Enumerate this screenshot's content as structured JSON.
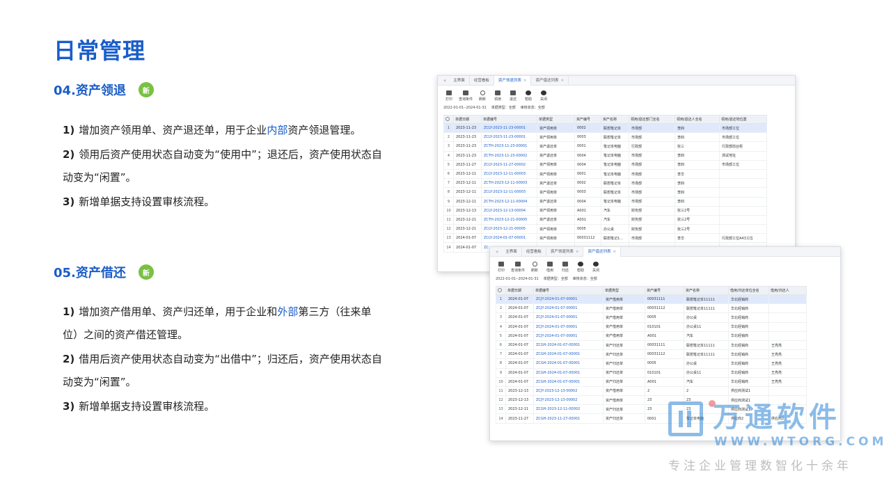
{
  "title": "日常管理",
  "badge": "新",
  "sections": [
    {
      "heading": "04.资产领退",
      "bullets": [
        {
          "num": "1)",
          "pre": "增加资产领用单、资产退还单，用于企业",
          "hl": "内部",
          "post": "资产领退管理。"
        },
        {
          "num": "2)",
          "pre": "领用后资产使用状态自动变为“使用中”；退还后，资产使用状态自动变为“闲置”。",
          "hl": "",
          "post": ""
        },
        {
          "num": "3)",
          "pre": "新增单据支持设置审核流程。",
          "hl": "",
          "post": ""
        }
      ]
    },
    {
      "heading": "05.资产借还",
      "bullets": [
        {
          "num": "1)",
          "pre": "增加资产借用单、资产归还单，用于企业和",
          "hl": "外部",
          "post": "第三方（往来单位）之间的资产借还管理。"
        },
        {
          "num": "2)",
          "pre": "借用后资产使用状态自动变为“出借中”；归还后，资产使用状态自动变为“闲置”。",
          "hl": "",
          "post": ""
        },
        {
          "num": "3)",
          "pre": "新增单据支持设置审核流程。",
          "hl": "",
          "post": ""
        }
      ]
    }
  ],
  "window1": {
    "tabs": [
      "主界面",
      "经营看板",
      "资产领退列表",
      "资产借还列表"
    ],
    "active_tab": 2,
    "toolbar": [
      "打印",
      "查询条件",
      "刷新",
      "领用",
      "退还",
      "帮助",
      "关闭"
    ],
    "filter": [
      "2022-01-01--2024-01-31",
      "单据类型：全部",
      "审核状态：全部"
    ],
    "columns": [
      "",
      "单据日期",
      "单据编号",
      "单据类型",
      "资产编号",
      "资产名称",
      "领用/退还部门全名",
      "领用/退还人全名",
      "领用/退还地位置"
    ],
    "rows": [
      [
        "1",
        "2023-11-23",
        "ZCLY-2023-11-23-00001",
        "资产领用单",
        "0002",
        "联想笔记本",
        "市场部",
        "李四",
        "市场部工位"
      ],
      [
        "2",
        "2023-11-23",
        "ZCLY-2023-11-23-00001",
        "资产领用单",
        "0003",
        "联想笔记本",
        "市场部",
        "李四",
        "市场部工位"
      ],
      [
        "3",
        "2023-11-23",
        "ZCTH-2023-11-23-00001",
        "资产退还单",
        "0001",
        "笔记本电脑",
        "行政部",
        "张三",
        "行政部前台柜"
      ],
      [
        "4",
        "2023-11-23",
        "ZCTH-2023-11-23-00002",
        "资产退还单",
        "0004",
        "笔记本电脑",
        "市场部",
        "李四",
        "测试地址"
      ],
      [
        "5",
        "2023-11-27",
        "ZCLY-2023-11-27-00002",
        "资产领用单",
        "0004",
        "笔记本电脑",
        "市场部",
        "李四",
        "市场部工位"
      ],
      [
        "6",
        "2023-12-11",
        "ZCLY-2023-12-11-00003",
        "资产领用单",
        "0001",
        "笔记本电脑",
        "市场部",
        "李华",
        ""
      ],
      [
        "7",
        "2023-12-11",
        "ZCTH-2023-12-11-00003",
        "资产退还单",
        "0002",
        "联想笔记本",
        "市场部",
        "李四",
        ""
      ],
      [
        "8",
        "2023-12-11",
        "ZCLY-2023-12-11-00003",
        "资产领用单",
        "0003",
        "联想笔记本",
        "市场部",
        "李四",
        ""
      ],
      [
        "9",
        "2023-12-11",
        "ZCTH-2023-12-11-00004",
        "资产退还单",
        "0004",
        "笔记本电脑",
        "市场部",
        "李四",
        ""
      ],
      [
        "10",
        "2023-12-13",
        "ZCLY-2023-12-13-00004",
        "资产领用单",
        "A001",
        "汽车",
        "财务部",
        "张三2号",
        ""
      ],
      [
        "11",
        "2023-12-21",
        "ZCTH-2023-12-21-00005",
        "资产退还单",
        "A001",
        "汽车",
        "财务部",
        "张三2号",
        ""
      ],
      [
        "12",
        "2023-12-21",
        "ZCLY-2023-12-21-00005",
        "资产领用单",
        "0005",
        "办公桌",
        "财务部",
        "张三2号",
        ""
      ],
      [
        "13",
        "2024-01-07",
        "ZCLY-2024-01-07-00001",
        "资产领用单",
        "00031112",
        "联想笔记1...",
        "市场部",
        "李华",
        "行政部工位A43工位"
      ],
      [
        "14",
        "2024-01-07",
        "ZC",
        "",
        "",
        "",
        "",
        "",
        ""
      ]
    ]
  },
  "window2": {
    "tabs": [
      "主界面",
      "经营看板",
      "资产领退列表",
      "资产借还列表"
    ],
    "active_tab": 3,
    "toolbar": [
      "打印",
      "查询条件",
      "刷新",
      "借用",
      "归还",
      "帮助",
      "关闭"
    ],
    "filter": [
      "2022-01-01--2024-01-31",
      "单据类型：全部",
      "审核状态：全部"
    ],
    "columns": [
      "",
      "单据日期",
      "单据编号",
      "单据类型",
      "资产编号",
      "资产名称",
      "借用/归还单位全名",
      "借用/归还人"
    ],
    "rows": [
      [
        "1",
        "2024-01-07",
        "ZCJY-2024-01-07-00001",
        "资产借用单",
        "00031111",
        "联想笔记本11111",
        "华北经销商",
        ""
      ],
      [
        "2",
        "2024-01-07",
        "ZCJY-2024-01-07-00001",
        "资产借用单",
        "00031112",
        "联想笔记本11111",
        "华北经销商",
        ""
      ],
      [
        "3",
        "2024-01-07",
        "ZCJY-2024-01-07-00001",
        "资产借用单",
        "0005",
        "办公桌",
        "华北经销商",
        ""
      ],
      [
        "4",
        "2024-01-07",
        "ZCJY-2024-01-07-00001",
        "资产借用单",
        "010101",
        "办公桌11",
        "华北经销商",
        ""
      ],
      [
        "5",
        "2024-01-07",
        "ZCJY-2024-01-07-00001",
        "资产借用单",
        "A001",
        "汽车",
        "华北经销商",
        ""
      ],
      [
        "6",
        "2024-01-07",
        "ZCGH-2024-01-07-00001",
        "资产归还单",
        "00031111",
        "联想笔记本11111",
        "华北经销商",
        "王亮亮"
      ],
      [
        "7",
        "2024-01-07",
        "ZCGH-2024-01-07-00001",
        "资产归还单",
        "00031112",
        "联想笔记本11111",
        "华北经销商",
        "王亮亮"
      ],
      [
        "8",
        "2024-01-07",
        "ZCGH-2024-01-07-00001",
        "资产归还单",
        "0005",
        "办公桌",
        "华北经销商",
        "王亮亮"
      ],
      [
        "9",
        "2024-01-07",
        "ZCGH-2024-01-07-00001",
        "资产归还单",
        "010101",
        "办公桌11",
        "华北经销商",
        "王亮亮"
      ],
      [
        "10",
        "2024-01-07",
        "ZCGH-2024-01-07-00001",
        "资产归还单",
        "A001",
        "汽车",
        "华北经销商",
        "王亮亮"
      ],
      [
        "11",
        "2023-12-13",
        "ZCJY-2023-12-13-00002",
        "资产借用单",
        "2",
        "2",
        "供应商测试1",
        ""
      ],
      [
        "12",
        "2023-12-13",
        "ZCJY-2023-12-13-00002",
        "资产借用单",
        "23",
        "23",
        "供应商测试1",
        ""
      ],
      [
        "13",
        "2023-12-11",
        "ZCGH-2023-12-11-00002",
        "资产归还单",
        "23",
        "23",
        "供应商测试1",
        ""
      ],
      [
        "14",
        "2023-11-27",
        "ZCGH-2023-11-27-00001",
        "资产归还单",
        "0001",
        "笔记本电脑",
        "供应商2",
        "供应商2"
      ]
    ]
  },
  "watermark": {
    "name": "万通软件",
    "url": "WWW.WTORG.COM",
    "slogan": "专注企业管理数智化十余年"
  }
}
